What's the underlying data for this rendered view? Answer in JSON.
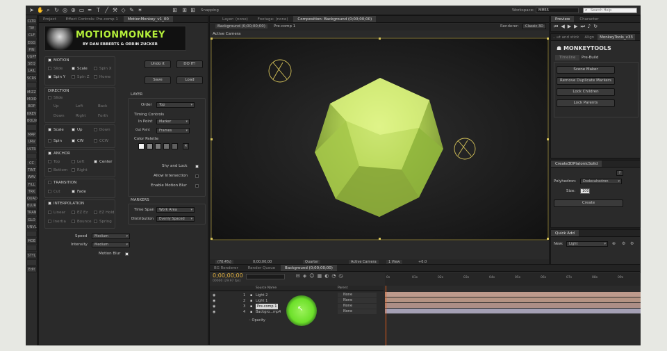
{
  "toolbar": {
    "snapping_label": "Snapping",
    "workspace_label": "Workspace:",
    "workspace_value": "MM55",
    "search_placeholder": "Search Help"
  },
  "left_tools": [
    "CLTR",
    "TIE",
    "CLF",
    "EGG",
    "PIN",
    "UGPF",
    "SEQ",
    "LAIL",
    "SCRS",
    "",
    "MIZZ",
    "MOID",
    "BOP",
    "KREV",
    "BOLN",
    "",
    "MAP",
    "URV",
    "LSTR",
    "",
    "CC",
    "TINT",
    "WAV",
    "FILL",
    "TRK",
    "QUAD",
    "BLUR",
    "TRAN",
    "GLO",
    "UNVL",
    "",
    "MOE",
    "",
    "STYL",
    "",
    "Edit"
  ],
  "project_panel": {
    "tabs": [
      "Project",
      "Effect Controls: Pre-comp 1",
      "MotionMonkey_v1_00"
    ],
    "logo_title": "MOTIONMONKEY",
    "logo_subtitle": "BY DAN EBBERTS & ORRIN ZUCKER",
    "motion": {
      "heading": "MOTION",
      "row1": [
        "Slide",
        "Scale",
        "Spin X"
      ],
      "row2": [
        "Spin Y",
        "Spin Z",
        "Home"
      ]
    },
    "direction": {
      "heading": "DIRECTION",
      "rows": [
        [
          "Slide"
        ],
        [
          "Up",
          "Left",
          "Back"
        ],
        [
          "Down",
          "Right",
          "Forth"
        ]
      ]
    },
    "scale_row": [
      "Scale",
      "Up",
      "Down"
    ],
    "spin_row": [
      "Spin",
      "CW",
      "CCW"
    ],
    "anchor": {
      "heading": "ANCHOR",
      "row1": [
        "Top",
        "Left",
        "Center"
      ],
      "row2": [
        "Bottom",
        "Right"
      ]
    },
    "transition": {
      "heading": "TRANSITION",
      "row": [
        "Cut",
        "Fade"
      ]
    },
    "interpolation": {
      "heading": "INTERPOLATION",
      "row1": [
        "Linear",
        "EZ Ez",
        "EZ Hold"
      ],
      "row2": [
        "Inertia",
        "Bounce",
        "Spring"
      ]
    },
    "speed_label": "Speed",
    "speed_value": "Medium",
    "intensity_label": "Intensity",
    "intensity_value": "Medium",
    "motion_blur_label": "Motion Blur",
    "buttons": {
      "undo": "Undo it",
      "doit": "DO IT!",
      "save": "Save",
      "load": "Load"
    },
    "layer": {
      "heading": "LAYER",
      "order_label": "Order",
      "order_value": "Top",
      "timing_heading": "Timing Controls",
      "in_point_label": "In Point",
      "in_point_value": "Marker",
      "out_point_label": "Out Point",
      "out_point_value": "Frames",
      "color_palette_label": "Color Palette",
      "shy_label": "Shy and Lock",
      "intersection_label": "Allow Intersection",
      "enable_motion_blur_label": "Enable Motion Blur"
    },
    "markers": {
      "heading": "MARKERS",
      "time_span_label": "Time Span",
      "time_span_value": "Work Area",
      "distribution_label": "Distribution",
      "distribution_value": "Evenly Spaced"
    }
  },
  "composition": {
    "tabs": [
      "Layer: (none)",
      "Footage: (none)",
      "Composition: Background (0;00;00;00)"
    ],
    "breadcrumbs": [
      "Background (0;00;00;00)",
      "Pre-comp 1"
    ],
    "renderer_label": "Renderer:",
    "renderer_value": "Classic 3D",
    "active_camera_label": "Active Camera",
    "footer": {
      "zoom": "(70.4%)",
      "timecode": "0;00;00;00",
      "resolution": "Quarter",
      "view": "Active Camera",
      "views": "1 View",
      "exposure": "+0.0"
    }
  },
  "preview": {
    "tabs": [
      "Preview",
      "Character"
    ]
  },
  "monkeytools": {
    "tabs": [
      "...ut and stick",
      "Align",
      "MonkeyTools_v33"
    ],
    "logo": "MONKEYTOOLS",
    "subtabs": [
      "Timeline",
      "Pre-Build"
    ],
    "buttons": [
      "Scene Maker",
      "Remove Duplicate Markers",
      "Lock Children",
      "Lock Parents"
    ]
  },
  "create3d": {
    "tab": "Create3DPlatonicSolid",
    "polyhedron_label": "Polyhedron:",
    "polyhedron_value": "Dodecahedron",
    "size_label": "Size:",
    "size_value": "100",
    "create_button": "Create"
  },
  "quickadd": {
    "tab": "Quick Add",
    "new_label": "New:",
    "new_value": "Light"
  },
  "timeline": {
    "tabs": [
      "BG Renderer",
      "Render Queue",
      "Background (0;00;00;00)"
    ],
    "timecode": "0;00;00;00",
    "frames_info": "00000 (29.97 fps)",
    "source_name_header": "Source Name",
    "parent_header": "Parent",
    "layers": [
      {
        "num": "1",
        "name": "Light 2",
        "parent": "None"
      },
      {
        "num": "2",
        "name": "Light 1",
        "parent": "None"
      },
      {
        "num": "3",
        "name": "Pre-comp 1",
        "parent": "None"
      },
      {
        "num": "4",
        "name": "Backgro...mp4",
        "parent": "None"
      }
    ],
    "opacity_label": "Opacity",
    "ruler": [
      "0s",
      "01s",
      "02s",
      "03s",
      "04s",
      "05s",
      "06s",
      "07s",
      "08s",
      "09s"
    ]
  }
}
